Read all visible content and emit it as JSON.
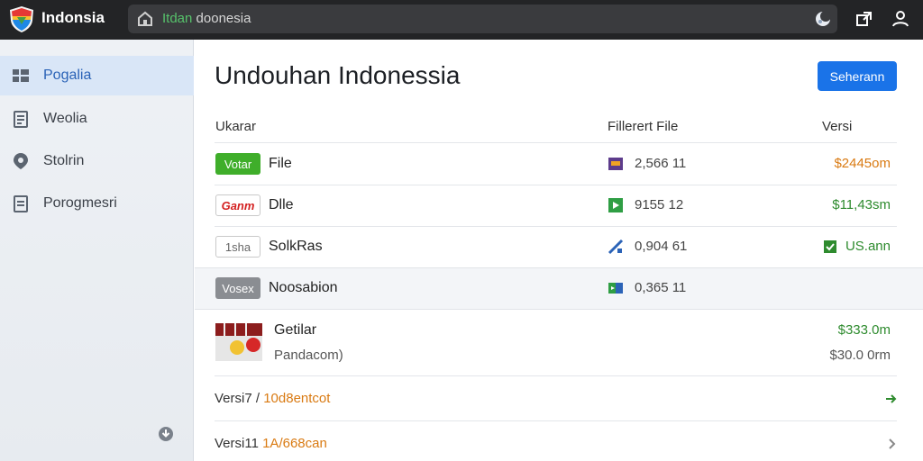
{
  "app": {
    "title": "Indonsia"
  },
  "url": {
    "prefix": "Itdan",
    "rest": " doonesia"
  },
  "sidebar": {
    "items": [
      {
        "label": "Pogalia",
        "icon": "grid-icon",
        "active": true
      },
      {
        "label": "Weolia",
        "icon": "document-icon",
        "active": false
      },
      {
        "label": "Stolrin",
        "icon": "location-pin-icon",
        "active": false
      },
      {
        "label": "Porogmesri",
        "icon": "list-document-icon",
        "active": false
      }
    ]
  },
  "main": {
    "title": "Undouhan Indonessia",
    "primary_button": "Seherann",
    "columns": {
      "name": "Ukarar",
      "file": "Fillerert File",
      "version": "Versi"
    },
    "rows": [
      {
        "badge": "Votar",
        "badge_style": "green",
        "name": "File",
        "file_num": "2,566 11",
        "price": "$2445om",
        "price_style": "orange"
      },
      {
        "badge": "Ganm",
        "badge_style": "outline-red",
        "name": "Dlle",
        "file_num": "9155 12",
        "price": "$11,43sm",
        "price_style": "green"
      },
      {
        "badge": "1sha",
        "badge_style": "outline-grey",
        "name": "SolkRas",
        "file_num": "0,904 61",
        "price": "US.ann",
        "price_style": "green"
      },
      {
        "badge": "Vosex",
        "badge_style": "grey",
        "name": "Noosabion",
        "file_num": "0,365 11",
        "price": "",
        "price_style": "grey"
      }
    ],
    "feature": {
      "title": "Getilar",
      "subtitle": "Pandacom)",
      "price_main": "$333.0m",
      "price_sub": "$30.0 0rm"
    },
    "links": [
      {
        "prefix": "Versi7 /",
        "accent": "10d8entcot"
      },
      {
        "prefix": "Versi11",
        "accent": "1A/668can"
      }
    ]
  },
  "colors": {
    "accent": "#1a73e8",
    "topbar": "#232426",
    "sidebar_active": "#d9e6f7"
  }
}
